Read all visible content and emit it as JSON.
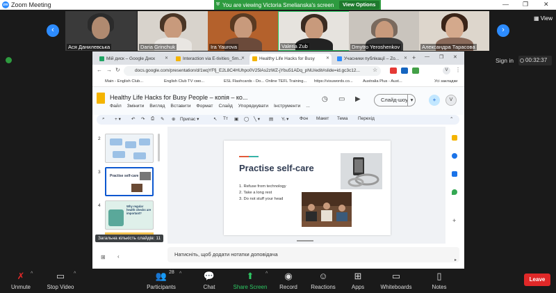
{
  "titlebar": {
    "app_title": "Zoom Meeting",
    "minimize": "—",
    "restore": "❐",
    "close": "✕"
  },
  "banner": {
    "text": "You are viewing Victoria Smelianska's screen",
    "options_label": "View Options ▾"
  },
  "gallery": {
    "participants": [
      {
        "name": "Ася Данилевська"
      },
      {
        "name": "Daria Grinchuk"
      },
      {
        "name": "Ira Yaurova"
      },
      {
        "name": "Valeria Zub"
      },
      {
        "name": "Dmytro Yeroshenkov"
      },
      {
        "name": "Александра Тарасова"
      }
    ],
    "prev": "‹",
    "next": "›",
    "view_label": "View"
  },
  "meeting": {
    "signin": "Sign in",
    "timer": "00:32:37"
  },
  "browser": {
    "tabs": [
      {
        "label": "Мій диск – Google Диск",
        "color": "#1fa463"
      },
      {
        "label": "Interaction via E-tivities_Sm...",
        "color": "#f4b400"
      },
      {
        "label": "Healthy Life Hacks for Busy",
        "color": "#f4b400"
      },
      {
        "label": "Учасники публікації – Zo...",
        "color": "#2d8cff"
      }
    ],
    "url": "docs.google.com/presentation/d/1wqYFfj_E2L8C4HUhpo0V25lAs2zWZ-jYbu51ADq_pNU/edit#slide=id.gc3c12...",
    "bookmarks": [
      "Main - English Club...",
      "English Club TV смо...",
      "ESL Flashcards - Do...",
      "Online TEFL Training...",
      "https://visuwords.co...",
      "Australia Plus - Aust...",
      "Усі закладки"
    ]
  },
  "slides_app": {
    "doc_title": "Healthy Life Hacks for Busy People – копія – ко...",
    "menu": [
      "Файл",
      "Змінити",
      "Вигляд",
      "Вставити",
      "Формат",
      "Слайд",
      "Упорядкувати",
      "Інструменти",
      "..."
    ],
    "slideshow_label": "Слайд-шоу",
    "avatar_letter": "V",
    "toolbar": {
      "fit": "Припас",
      "background": "Фон",
      "layout": "Макет",
      "theme": "Тема",
      "transition": "Перехід"
    },
    "filmstrip": [
      {
        "num": "2"
      },
      {
        "num": "3"
      },
      {
        "num": "4"
      }
    ],
    "thumb4_title": "Why regular health checks are important?",
    "thumb3_title": "Practise self-care",
    "tooltip": "Загальна кількість слайдів: 11",
    "slide": {
      "title": "Practise self-care",
      "items": [
        "1.   Refuse  from technology",
        "2.   Take a long rest",
        "3.   Do not stuff your head"
      ]
    },
    "notes_placeholder": "Натисніть, щоб додати нотатки доповідача"
  },
  "zoom_toolbar": {
    "unmute": "Unmute",
    "stop_video": "Stop Video",
    "participants": "Participants",
    "participants_count": "28",
    "chat": "Chat",
    "share_screen": "Share Screen",
    "record": "Record",
    "reactions": "Reactions",
    "apps": "Apps",
    "whiteboards": "Whiteboards",
    "notes": "Notes",
    "leave": "Leave"
  }
}
